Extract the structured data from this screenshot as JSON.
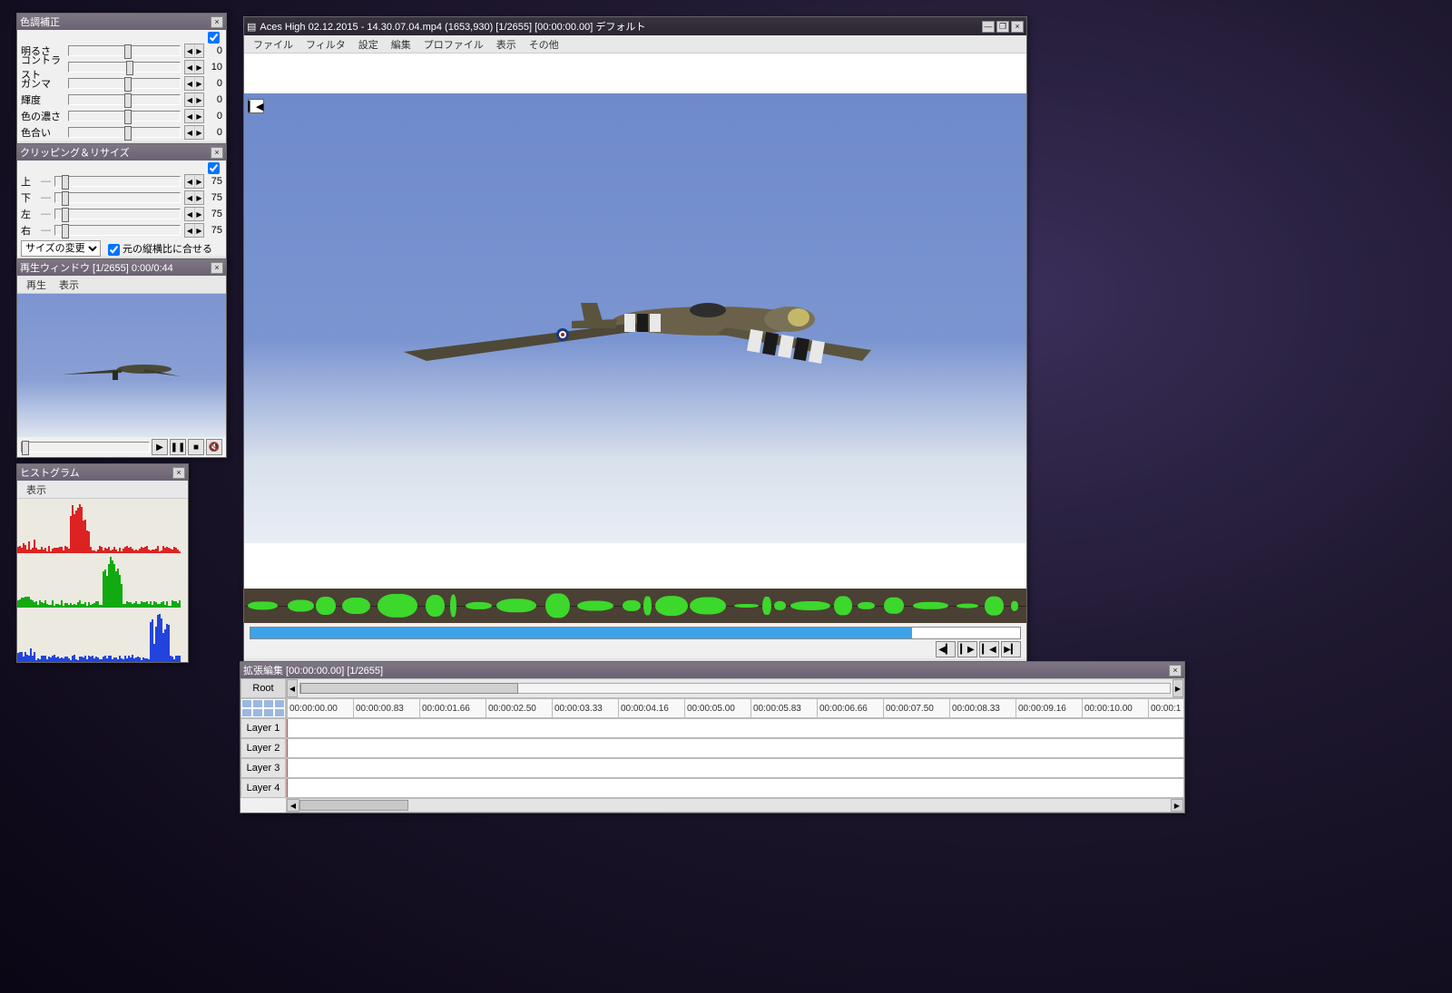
{
  "main": {
    "title": "Aces High 02.12.2015 - 14.30.07.04.mp4 (1653,930) [1/2655] [00:00:00.00] デフォルト",
    "menus": [
      "ファイル",
      "フィルタ",
      "設定",
      "編集",
      "プロファイル",
      "表示",
      "その他"
    ],
    "progress_percent": 86,
    "nav": {
      "prev_frame": "◀▎",
      "next_frame": "▎▶",
      "start": "▎◀",
      "end": "▶▎"
    }
  },
  "cc": {
    "title": "色調補正",
    "rows": [
      {
        "label": "明るさ",
        "value": 0,
        "pos": 50
      },
      {
        "label": "コントラスト",
        "value": 10,
        "pos": 52
      },
      {
        "label": "ガンマ",
        "value": 0,
        "pos": 50
      },
      {
        "label": "輝度",
        "value": 0,
        "pos": 50
      },
      {
        "label": "色の濃さ",
        "value": 0,
        "pos": 50
      },
      {
        "label": "色合い",
        "value": 0,
        "pos": 50
      }
    ]
  },
  "cr": {
    "title": "クリッピング＆リサイズ",
    "rows": [
      {
        "label": "上",
        "value": 75,
        "pos": 5
      },
      {
        "label": "下",
        "value": 75,
        "pos": 5
      },
      {
        "label": "左",
        "value": 75,
        "pos": 5
      },
      {
        "label": "右",
        "value": 75,
        "pos": 5
      }
    ],
    "resize_label": "サイズの変更",
    "checkbox_label": "元の縦横比に合せる"
  },
  "pb": {
    "title": "再生ウィンドウ  [1/2655]  0:00/0:44",
    "menus": [
      "再生",
      "表示"
    ],
    "ctrl": {
      "play": "▶",
      "pause": "❚❚",
      "stop": "■",
      "sound": "🔇"
    }
  },
  "hist": {
    "title": "ヒストグラム",
    "menu": "表示"
  },
  "tl": {
    "title": "拡張編集 [00:00:00.00] [1/2655]",
    "root_label": "Root",
    "layers": [
      "Layer 1",
      "Layer 2",
      "Layer 3",
      "Layer 4"
    ],
    "ticks": [
      "00:00:00.00",
      "00:00:00.83",
      "00:00:01.66",
      "00:00:02.50",
      "00:00:03.33",
      "00:00:04.16",
      "00:00:05.00",
      "00:00:05.83",
      "00:00:06.66",
      "00:00:07.50",
      "00:00:08.33",
      "00:00:09.16",
      "00:00:10.00",
      "00:00:1"
    ]
  },
  "icons": {
    "close": "×",
    "min": "—",
    "max": "❐",
    "left": "◀",
    "right": "▶",
    "app": "▤"
  }
}
